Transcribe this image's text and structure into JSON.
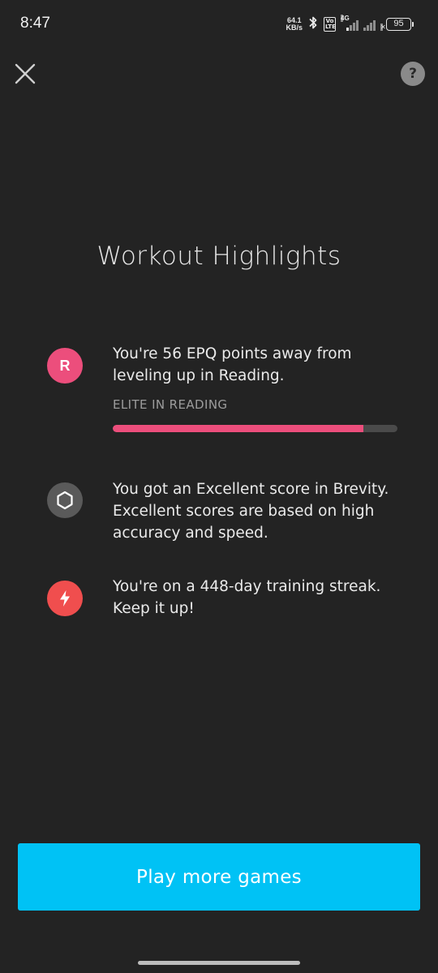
{
  "status_bar": {
    "time": "8:47",
    "net_speed_value": "64.1",
    "net_speed_unit": "KB/s",
    "volte_top": "Vo",
    "volte_bottom": "LTE",
    "network_type": "4G",
    "battery": "95"
  },
  "header": {
    "help_label": "?"
  },
  "title": "Workout Highlights",
  "highlights": [
    {
      "icon": "reading-badge-icon",
      "icon_letter": "R",
      "icon_color": "#ec4e7c",
      "text_line1": "You're 56 EPQ points away from",
      "text_line2": "leveling up in Reading.",
      "progress_label": "ELITE IN READING",
      "progress_fraction": 0.88
    },
    {
      "icon": "hexagon-icon",
      "icon_color": "#5a5a5a",
      "text_line1": "You got an Excellent score in Brevity.",
      "text_line2": "Excellent scores are based on high",
      "text_line3": "accuracy and speed."
    },
    {
      "icon": "lightning-bolt-icon",
      "icon_color": "#f04e4e",
      "text_line1": "You're on a 448-day training streak.",
      "text_line2": "Keep it up!"
    }
  ],
  "cta": {
    "label": "Play more games",
    "color": "#00c2f5"
  }
}
